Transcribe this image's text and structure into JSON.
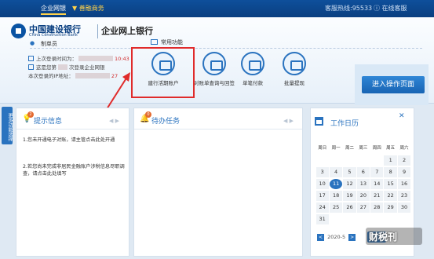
{
  "topbar": {
    "enterprise_label": "企业网银",
    "cart_label": "▼ 善融商务",
    "hotline": "客服热线:95533",
    "online_service": "ⓘ 在线客服",
    "accent": "#0e4f9b"
  },
  "brand": {
    "name_cn": "中国建设银行",
    "name_en": "China Construction Bank",
    "product": "企业网上银行"
  },
  "user": {
    "role": "制单员",
    "last_login_label": "上次登录时间为：",
    "last_login_time": "10:43",
    "welcome_prefix": "这是您第",
    "welcome_suffix": "次登录企业网银",
    "ip_label": "本次登录的IP地址：",
    "ip_tail": "27"
  },
  "functions": {
    "section_title": "常用功能",
    "items": [
      {
        "label": "建行活期账户",
        "icon": "account-icon"
      },
      {
        "label": "对账单查询与回签",
        "icon": "statement-icon"
      },
      {
        "label": "单笔付款",
        "icon": "payment-icon"
      },
      {
        "label": "批量提现",
        "icon": "batch-icon"
      }
    ],
    "enter_button": "进入操作页面"
  },
  "sidetab": {
    "label": "更多功能选择"
  },
  "hint_panel": {
    "title": "提示信息",
    "badge": "2",
    "messages": [
      "1.您未开通电子对账，请主管点击此处开通",
      "2.若您尚未完成非居民金融账户涉税信息尽职调查，请点击此处填写"
    ]
  },
  "task_panel": {
    "title": "待办任务",
    "badge": "0"
  },
  "calendar": {
    "title": "工作日历",
    "close": "✕",
    "weekdays": [
      "周日",
      "周一",
      "周二",
      "周三",
      "周四",
      "周五",
      "周六"
    ],
    "weeks": [
      [
        "",
        "",
        "",
        "",
        "",
        "1",
        "2"
      ],
      [
        "3",
        "4",
        "5",
        "6",
        "7",
        "8",
        "9"
      ],
      [
        "10",
        "11",
        "12",
        "13",
        "14",
        "15",
        "16"
      ],
      [
        "17",
        "18",
        "19",
        "20",
        "21",
        "22",
        "23"
      ],
      [
        "24",
        "25",
        "26",
        "27",
        "28",
        "29",
        "30"
      ],
      [
        "31",
        "",
        "",
        "",
        "",
        "",
        ""
      ]
    ],
    "today": "11",
    "month_label": "2020-5",
    "prev": "<",
    "next": ">"
  },
  "watermark": {
    "text": "财税刊"
  }
}
